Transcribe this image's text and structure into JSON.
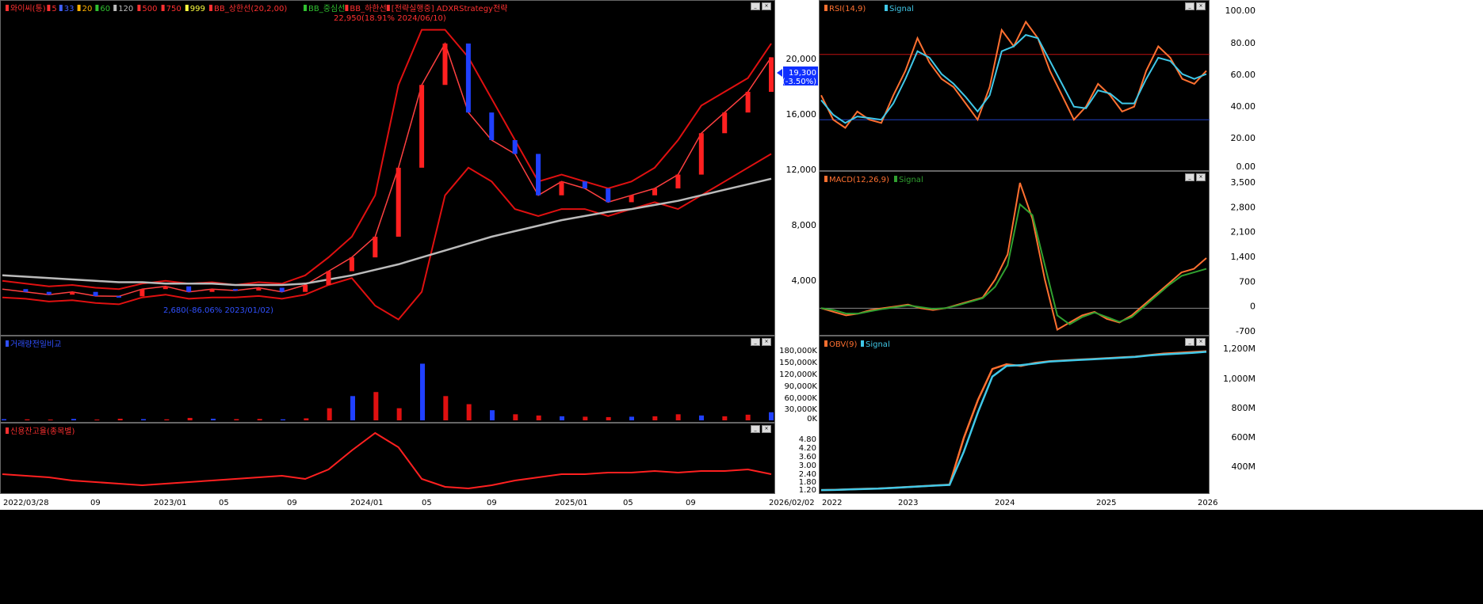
{
  "legend": {
    "main": [
      {
        "text": "와이씨(통)",
        "color": "#ff3030"
      },
      {
        "text": "5",
        "color": "#ff3030"
      },
      {
        "text": "33",
        "color": "#4060ff"
      },
      {
        "text": "20",
        "color": "#ffb000"
      },
      {
        "text": "60",
        "color": "#30c030"
      },
      {
        "text": "120",
        "color": "#bbbbbb"
      },
      {
        "text": "500",
        "color": "#ff3030"
      },
      {
        "text": "750",
        "color": "#ff3030"
      },
      {
        "text": "999",
        "color": "#ffff40"
      },
      {
        "text": "BB_상한선(20,2,00)",
        "color": "#ff3030"
      },
      {
        "text": "BB_중심선",
        "color": "#30c030"
      },
      {
        "text": "BB_하한선",
        "color": "#ff3030"
      },
      {
        "text": "[전략실행중] ADXRStrategy전략",
        "color": "#ff3030"
      }
    ],
    "high_annotation": "22,950(18.91% 2024/06/10)",
    "low_annotation": "2,680(-86.06% 2023/01/02)",
    "current_price": "19,300",
    "current_change": "(-3.50%)",
    "volume": "거래량전일비교",
    "credit": "신용잔고율(종목별)",
    "rsi": "RSI(14,9)",
    "rsi_signal": "Signal",
    "macd": "MACD(12,26,9)",
    "macd_signal": "Signal",
    "obv": "OBV(9)",
    "obv_signal": "Signal"
  },
  "axes": {
    "price_ticks": [
      "20,000",
      "16,000",
      "12,000",
      "8,000",
      "4,000"
    ],
    "volume_ticks": [
      "180,000K",
      "150,000K",
      "120,000K",
      "90,000K",
      "60,000K",
      "30,000K",
      "0K"
    ],
    "credit_ticks": [
      "4.80",
      "4.20",
      "3.60",
      "3.00",
      "2.40",
      "1.80",
      "1.20"
    ],
    "rsi_ticks": [
      "100.00",
      "80.00",
      "60.00",
      "40.00",
      "20.00",
      "0.00"
    ],
    "macd_ticks": [
      "3,500",
      "2,800",
      "2,100",
      "1,400",
      "700",
      "0",
      "-700"
    ],
    "obv_ticks": [
      "1,200M",
      "1,000M",
      "800M",
      "600M",
      "400M"
    ],
    "left_dates": [
      "2022/03/28",
      "09",
      "2023/01",
      "05",
      "09",
      "2024/01",
      "05",
      "09",
      "2025/01",
      "05",
      "09",
      "2026/02/02"
    ],
    "right_dates": [
      "2022",
      "2023",
      "2024",
      "2025",
      "2026"
    ]
  },
  "chart_data": [
    {
      "type": "line",
      "title": "와이씨(통)",
      "x_range": [
        "2022/03/28",
        "2026/02/02"
      ],
      "ylim": [
        0,
        22950
      ],
      "series": [
        {
          "name": "Price",
          "values": [
            3200,
            3000,
            2800,
            3000,
            2700,
            2680,
            3200,
            3400,
            3000,
            3200,
            3100,
            3300,
            3000,
            3500,
            4500,
            5500,
            7000,
            12000,
            18000,
            21000,
            16000,
            14000,
            13000,
            10000,
            11000,
            10500,
            9500,
            10000,
            10500,
            11500,
            14500,
            16000,
            17500,
            20000
          ]
        },
        {
          "name": "BB_상한선",
          "values": [
            3800,
            3600,
            3400,
            3500,
            3300,
            3200,
            3600,
            3800,
            3600,
            3700,
            3500,
            3700,
            3600,
            4200,
            5500,
            7000,
            10000,
            18000,
            22000,
            22000,
            20000,
            17000,
            14000,
            11000,
            11500,
            11000,
            10500,
            11000,
            12000,
            14000,
            16500,
            17500,
            18500,
            21000
          ]
        },
        {
          "name": "BB_하한선",
          "values": [
            2600,
            2500,
            2300,
            2400,
            2200,
            2100,
            2600,
            2800,
            2500,
            2600,
            2600,
            2700,
            2500,
            2800,
            3500,
            4000,
            2000,
            1000,
            3000,
            10000,
            12000,
            11000,
            9000,
            8500,
            9000,
            9000,
            8500,
            9000,
            9500,
            9000,
            10000,
            11000,
            12000,
            13000
          ]
        },
        {
          "name": "120",
          "values": [
            4200,
            4100,
            4000,
            3900,
            3800,
            3700,
            3700,
            3600,
            3600,
            3600,
            3500,
            3500,
            3500,
            3600,
            3900,
            4200,
            4600,
            5000,
            5500,
            6000,
            6500,
            7000,
            7400,
            7800,
            8200,
            8500,
            8800,
            9000,
            9300,
            9600,
            10000,
            10400,
            10800,
            11200
          ]
        }
      ]
    },
    {
      "type": "bar",
      "title": "거래량전일비교",
      "ylim": [
        0,
        180000
      ],
      "values": [
        3000,
        2500,
        2000,
        3500,
        2000,
        4000,
        3000,
        2500,
        6000,
        4000,
        3000,
        3500,
        2500,
        5000,
        30000,
        60000,
        70000,
        30000,
        140000,
        60000,
        40000,
        25000,
        15000,
        12000,
        10000,
        9000,
        8000,
        9000,
        10000,
        15000,
        12000,
        10000,
        14000,
        20000
      ]
    },
    {
      "type": "line",
      "title": "신용잔고율(종목별)",
      "ylim": [
        1.2,
        4.8
      ],
      "values": [
        2.3,
        2.2,
        2.1,
        1.9,
        1.8,
        1.7,
        1.6,
        1.7,
        1.8,
        1.9,
        2.0,
        2.1,
        2.2,
        2.0,
        2.6,
        3.8,
        4.9,
        4.0,
        2.0,
        1.5,
        1.4,
        1.6,
        1.9,
        2.1,
        2.3,
        2.3,
        2.4,
        2.4,
        2.5,
        2.4,
        2.5,
        2.5,
        2.6,
        2.3
      ]
    },
    {
      "type": "line",
      "title": "RSI(14,9)",
      "ylim": [
        0,
        100
      ],
      "series": [
        {
          "name": "RSI",
          "values": [
            45,
            30,
            25,
            35,
            30,
            28,
            45,
            60,
            80,
            65,
            55,
            50,
            40,
            30,
            50,
            85,
            75,
            90,
            80,
            60,
            45,
            30,
            38,
            52,
            45,
            35,
            38,
            60,
            75,
            68,
            55,
            52,
            60
          ]
        },
        {
          "name": "Signal",
          "values": [
            42,
            33,
            28,
            32,
            31,
            30,
            40,
            55,
            72,
            68,
            58,
            52,
            44,
            35,
            45,
            72,
            75,
            82,
            80,
            66,
            52,
            38,
            37,
            48,
            46,
            40,
            40,
            55,
            68,
            66,
            58,
            55,
            58
          ]
        }
      ],
      "reference_lines": [
        70,
        30
      ]
    },
    {
      "type": "line",
      "title": "MACD(12,26,9)",
      "ylim": [
        -700,
        3500
      ],
      "series": [
        {
          "name": "MACD",
          "values": [
            0,
            -100,
            -200,
            -150,
            -50,
            0,
            50,
            100,
            0,
            -50,
            0,
            100,
            200,
            300,
            800,
            1500,
            3500,
            2500,
            800,
            -600,
            -400,
            -200,
            -100,
            -300,
            -400,
            -200,
            100,
            400,
            700,
            1000,
            1100,
            1400
          ]
        },
        {
          "name": "Signal",
          "values": [
            0,
            -50,
            -150,
            -150,
            -80,
            -20,
            30,
            80,
            30,
            -20,
            0,
            80,
            180,
            280,
            600,
            1200,
            2900,
            2600,
            1200,
            -200,
            -450,
            -250,
            -120,
            -250,
            -380,
            -250,
            50,
            350,
            650,
            900,
            1000,
            1100
          ]
        }
      ],
      "reference_lines": [
        0
      ]
    },
    {
      "type": "line",
      "title": "OBV(9)",
      "ylim": [
        300,
        1250
      ],
      "series": [
        {
          "name": "OBV",
          "values": [
            310,
            312,
            315,
            318,
            320,
            325,
            330,
            335,
            340,
            345,
            650,
            900,
            1100,
            1130,
            1120,
            1140,
            1150,
            1155,
            1160,
            1165,
            1170,
            1175,
            1180,
            1190,
            1200,
            1205,
            1210,
            1215
          ]
        },
        {
          "name": "Signal",
          "values": [
            310,
            311,
            314,
            317,
            319,
            324,
            329,
            334,
            339,
            344,
            560,
            820,
            1050,
            1120,
            1125,
            1135,
            1148,
            1153,
            1158,
            1163,
            1168,
            1173,
            1178,
            1188,
            1195,
            1200,
            1205,
            1212
          ]
        }
      ]
    }
  ]
}
